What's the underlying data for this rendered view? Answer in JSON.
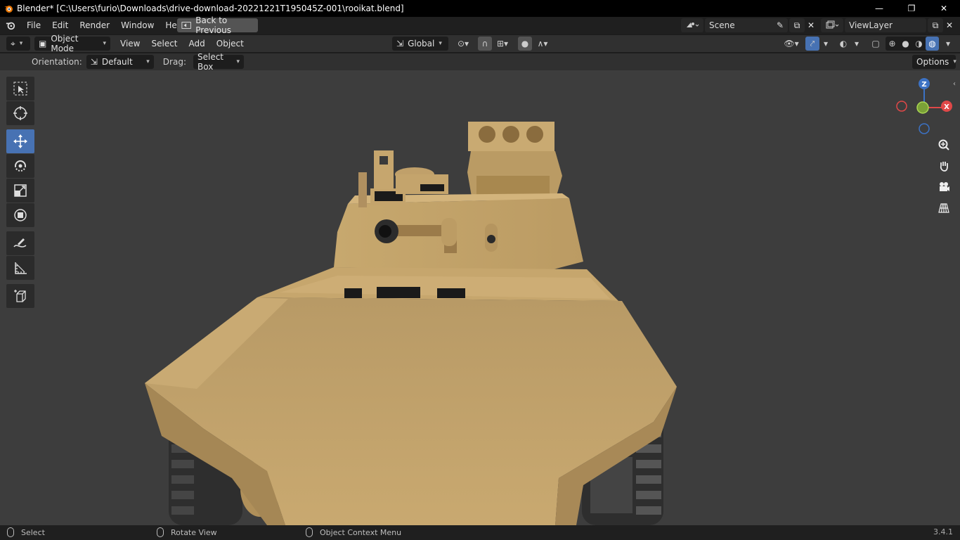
{
  "window": {
    "title": "Blender* [C:\\Users\\furio\\Downloads\\drive-download-20221221T195045Z-001\\rooikat.blend]",
    "minimize": "—",
    "restore": "❐",
    "close": "✕"
  },
  "menubar": {
    "items": [
      "File",
      "Edit",
      "Render",
      "Window",
      "Help"
    ],
    "back_button": "Back to Previous",
    "scene": "Scene",
    "view_layer": "ViewLayer"
  },
  "viewheader": {
    "mode": "Object Mode",
    "menus": [
      "View",
      "Select",
      "Add",
      "Object"
    ],
    "transform_orientation": "Global"
  },
  "toolheader": {
    "orientation_label": "Orientation:",
    "orientation_value": "Default",
    "drag_label": "Drag:",
    "drag_value": "Select Box",
    "options": "Options"
  },
  "gizmo": {
    "z": "Z",
    "x": "X"
  },
  "statusbar": {
    "select": "Select",
    "rotate": "Rotate View",
    "context": "Object Context Menu",
    "version": "3.4.1"
  },
  "colors": {
    "accent": "#4772b3",
    "model": "#c8a56e",
    "viewport_bg": "#3d3d3d"
  }
}
